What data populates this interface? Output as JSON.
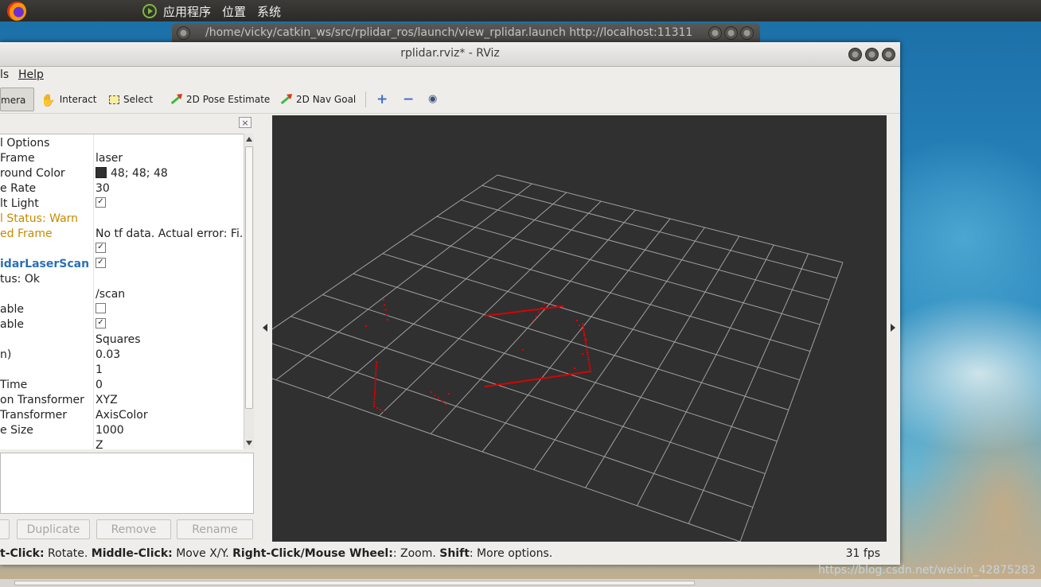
{
  "top_panel": {
    "menus": [
      "应用程序",
      "位置",
      "系统"
    ]
  },
  "background_window": {
    "title": "/home/vicky/catkin_ws/src/rplidar_ros/launch/view_rplidar.launch http://localhost:11311"
  },
  "window": {
    "title": "rplidar.rviz* - RViz"
  },
  "menubar": {
    "items": [
      "ls",
      "Help"
    ]
  },
  "toolbar": {
    "tools": [
      "mera",
      "Interact",
      "Select",
      "2D Pose Estimate",
      "2D Nav Goal"
    ],
    "icons": [
      "move-camera-icon",
      "hand-icon",
      "select-icon",
      "pose-estimate-arrow-icon",
      "nav-goal-arrow-icon",
      "add-icon",
      "remove-icon",
      "eye-icon"
    ]
  },
  "displays": {
    "rows": [
      {
        "key": "l Options",
        "value": "",
        "style": "normal"
      },
      {
        "key": "Frame",
        "value": "laser",
        "style": "normal"
      },
      {
        "key": "round Color",
        "value": "48; 48; 48",
        "style": "color",
        "color": "#303030"
      },
      {
        "key": "e Rate",
        "value": "30",
        "style": "normal"
      },
      {
        "key": "lt Light",
        "value": "✓",
        "style": "checkbox"
      },
      {
        "key": "l Status: Warn",
        "value": "",
        "style": "warn"
      },
      {
        "key": "ed Frame",
        "value": "No tf data.  Actual error: Fi.",
        "style": "warn"
      },
      {
        "key": "",
        "value": "✓",
        "style": "checkbox"
      },
      {
        "key": "idarLaserScan",
        "value": "✓",
        "style": "blue-checkbox"
      },
      {
        "key": "tus: Ok",
        "value": "",
        "style": "normal"
      },
      {
        "key": "",
        "value": "/scan",
        "style": "normal"
      },
      {
        "key": "able",
        "value": "",
        "style": "checkbox-empty"
      },
      {
        "key": "able",
        "value": "✓",
        "style": "checkbox"
      },
      {
        "key": "",
        "value": "Squares",
        "style": "normal"
      },
      {
        "key": "n)",
        "value": "0.03",
        "style": "normal"
      },
      {
        "key": "",
        "value": "1",
        "style": "normal"
      },
      {
        "key": "Time",
        "value": "0",
        "style": "normal"
      },
      {
        "key": "on Transformer",
        "value": "XYZ",
        "style": "normal"
      },
      {
        "key": "Transformer",
        "value": "AxisColor",
        "style": "normal"
      },
      {
        "key": "e Size",
        "value": "1000",
        "style": "normal"
      },
      {
        "key": "",
        "value": "Z",
        "style": "normal"
      }
    ],
    "buttons": [
      "Duplicate",
      "Remove",
      "Rename"
    ]
  },
  "view": {
    "background_color": "#303030",
    "grid_color": "#a0a0a0",
    "scan_color": "#e00000",
    "grid_cells": 10
  },
  "statusbar": {
    "text_parts": [
      {
        "b": "t-Click:",
        "t": " Rotate. "
      },
      {
        "b": "Middle-Click:",
        "t": " Move X/Y. "
      },
      {
        "b": "Right-Click/Mouse Wheel:",
        "t": ": Zoom. "
      },
      {
        "b": "Shift",
        "t": ": More options."
      }
    ],
    "fps": "31 fps"
  },
  "watermark": "https://blog.csdn.net/weixin_42875283"
}
